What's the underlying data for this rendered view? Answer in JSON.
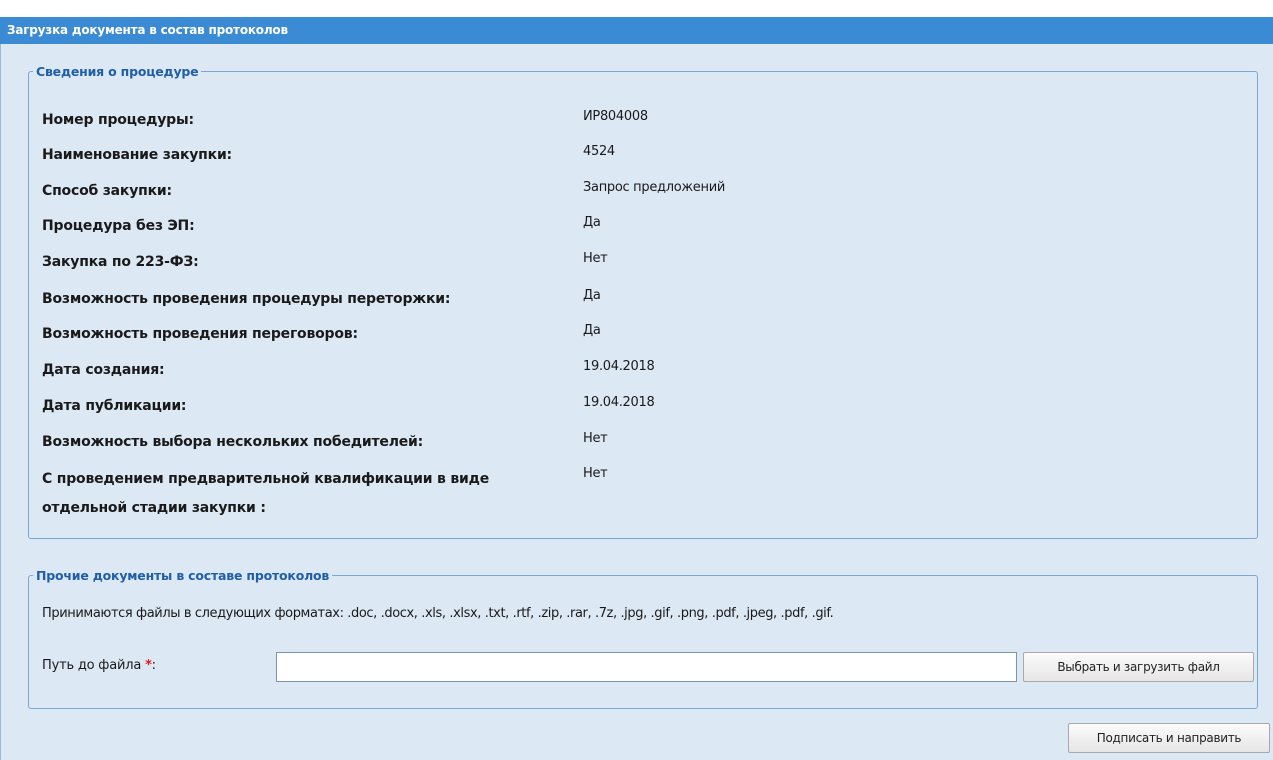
{
  "window": {
    "title": "Загрузка документа в состав протоколов"
  },
  "procedure_info": {
    "legend": "Сведения о процедуре",
    "rows": [
      {
        "label": "Номер процедуры:",
        "value": "ИР804008"
      },
      {
        "label": "Наименование закупки:",
        "value": "4524"
      },
      {
        "label": "Способ закупки:",
        "value": "Запрос предложений"
      },
      {
        "label": "Процедура без ЭП:",
        "value": "Да"
      },
      {
        "label": "Закупка по 223-ФЗ:",
        "value": "Нет"
      },
      {
        "label": "Возможность проведения процедуры переторжки:",
        "value": "Да"
      },
      {
        "label": "Возможность проведения переговоров:",
        "value": "Да"
      },
      {
        "label": "Дата создания:",
        "value": "19.04.2018"
      },
      {
        "label": "Дата публикации:",
        "value": "19.04.2018"
      },
      {
        "label": "Возможность выбора нескольких победителей:",
        "value": "Нет"
      },
      {
        "label": "С проведением предварительной квалификации в виде отдельной стадии закупки :",
        "value": "Нет"
      }
    ]
  },
  "other_docs": {
    "legend": "Прочие документы в составе протоколов",
    "formats_text": "Принимаются файлы в следующих форматах: .doc, .docx, .xls, .xlsx, .txt, .rtf, .zip, .rar, .7z, .jpg, .gif, .png, .pdf, .jpeg, .pdf, .gif.",
    "path_label": "Путь до файла",
    "required_mark": "*",
    "path_suffix": ":",
    "path_value": "",
    "upload_button": "Выбрать и загрузить файл"
  },
  "actions": {
    "sign_button": "Подписать и направить"
  }
}
